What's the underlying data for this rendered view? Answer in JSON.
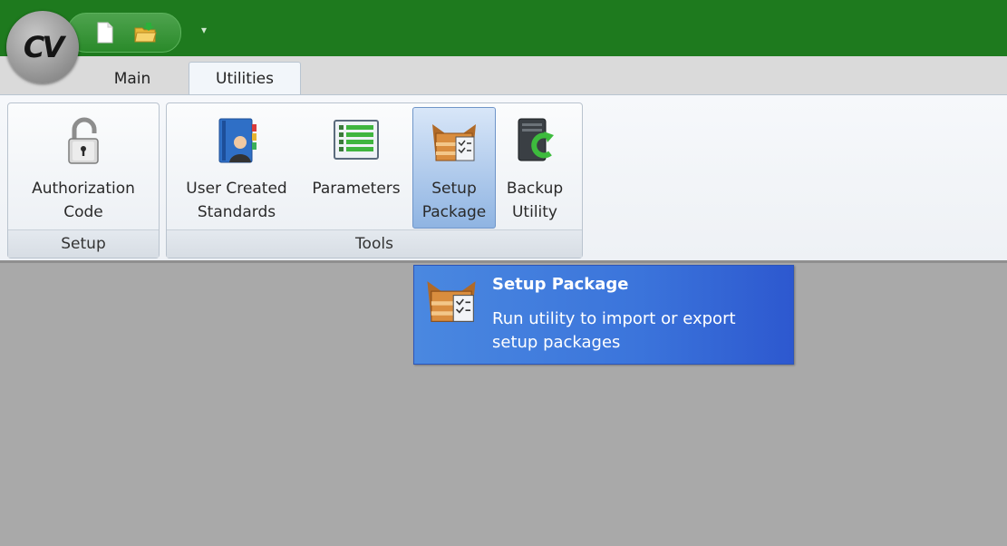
{
  "app": {
    "logo_text": "CV"
  },
  "tabs": [
    {
      "label": "Main"
    },
    {
      "label": "Utilities"
    }
  ],
  "ribbon": {
    "groups": [
      {
        "label": "Setup",
        "buttons": [
          {
            "label": "Authorization\nCode",
            "icon": "lock-icon"
          }
        ]
      },
      {
        "label": "Tools",
        "buttons": [
          {
            "label": "User Created\nStandards",
            "icon": "user-book-icon"
          },
          {
            "label": "Parameters",
            "icon": "list-icon"
          },
          {
            "label": "Setup\nPackage",
            "icon": "package-icon"
          },
          {
            "label": "Backup\nUtility",
            "icon": "backup-icon"
          }
        ]
      }
    ]
  },
  "tooltip": {
    "title": "Setup Package",
    "description": "Run utility to import or export setup packages"
  },
  "colors": {
    "titlebar": "#1e7a1e",
    "tooltip": "#3b74db",
    "workspace": "#a9a9a9"
  }
}
